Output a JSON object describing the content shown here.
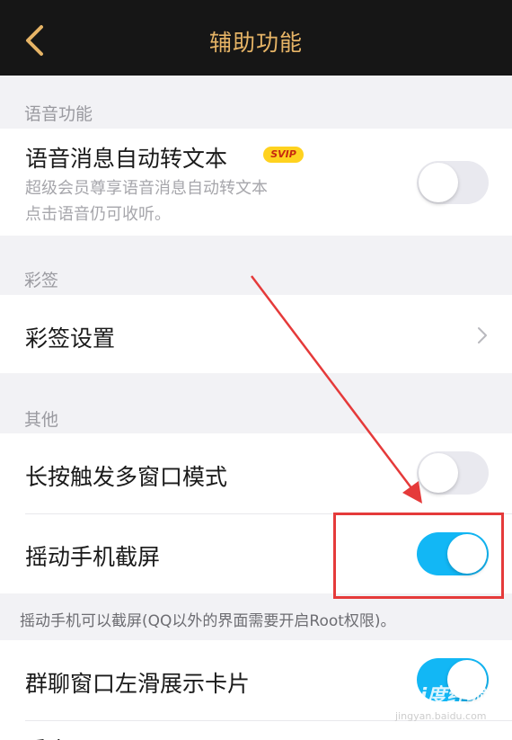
{
  "header": {
    "title": "辅助功能"
  },
  "sections": {
    "voice": {
      "label": "语音功能",
      "row": {
        "title": "语音消息自动转文本",
        "badge": "SVIP",
        "subtitle_line1": "超级会员尊享语音消息自动转文本",
        "subtitle_line2": "点击语音仍可收听。",
        "toggle_on": false
      }
    },
    "caiqian": {
      "label": "彩签",
      "row": {
        "title": "彩签设置"
      }
    },
    "other": {
      "label": "其他",
      "rows": [
        {
          "title": "长按触发多窗口模式",
          "toggle_on": false
        },
        {
          "title": "摇动手机截屏",
          "toggle_on": true
        }
      ],
      "note": "摇动手机可以截屏(QQ以外的界面需要开启Root权限)。"
    },
    "extra": {
      "rows": [
        {
          "title": "群聊窗口左滑展示卡片",
          "toggle_on": true
        },
        {
          "title": "重点",
          "toggle_on": false
        }
      ]
    }
  },
  "watermark": {
    "text": "Bai度经验",
    "sub": "jingyan.baidu.com"
  },
  "colors": {
    "accent_title": "#e6b466",
    "toggle_on": "#12b7f5",
    "highlight": "#e53a3a"
  }
}
